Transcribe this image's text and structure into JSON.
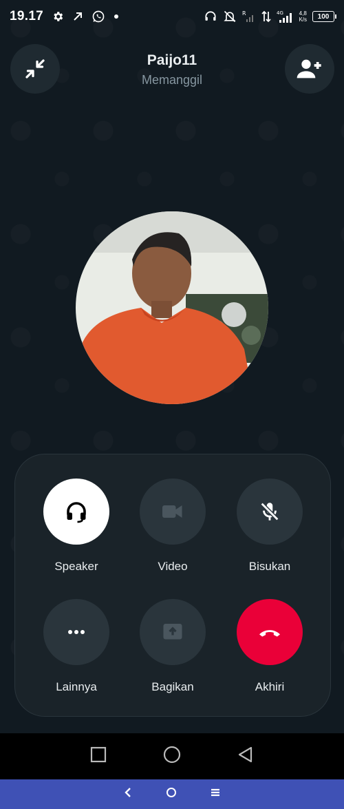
{
  "status_bar": {
    "time": "19.17",
    "net_speed_value": "4,8",
    "net_speed_unit": "K/s",
    "network_type": "4G",
    "battery": "100"
  },
  "call": {
    "name": "Paijo11",
    "status": "Memanggil"
  },
  "controls": {
    "speaker": "Speaker",
    "video": "Video",
    "mute": "Bisukan",
    "more": "Lainnya",
    "share": "Bagikan",
    "end": "Akhiri"
  },
  "colors": {
    "background": "#111a21",
    "end_call": "#ea0038",
    "active_button": "#ffffff",
    "bottom_nav": "#3f51b5"
  }
}
